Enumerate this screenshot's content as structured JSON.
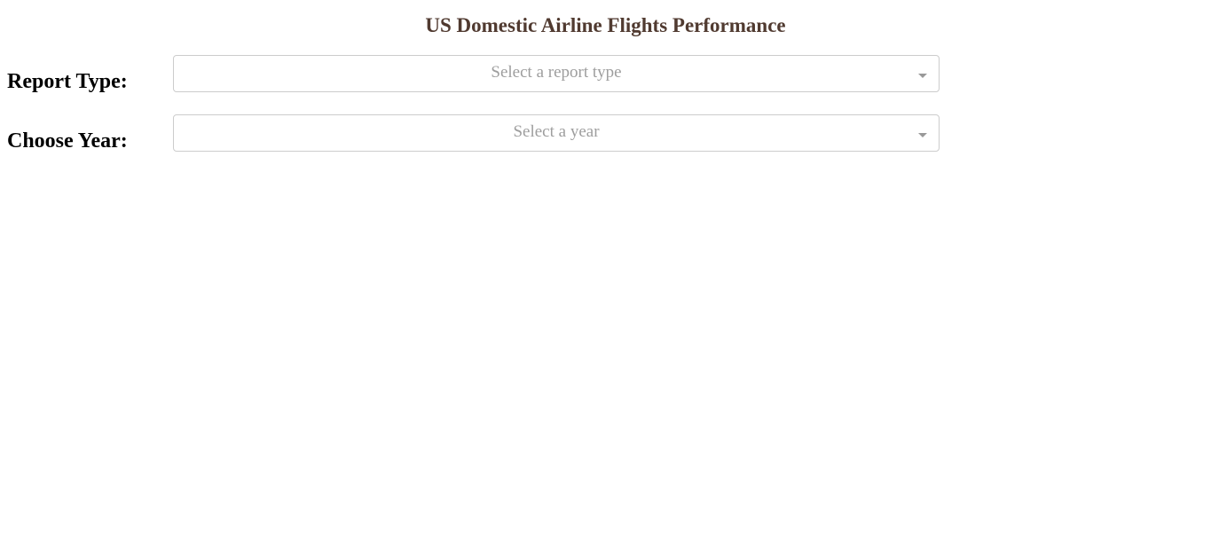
{
  "header": {
    "title": "US Domestic Airline Flights Performance"
  },
  "form": {
    "report_type": {
      "label": "Report Type:",
      "placeholder": "Select a report type"
    },
    "year": {
      "label": "Choose Year:",
      "placeholder": "Select a year"
    }
  },
  "icons": {
    "dropdown_arrow": "caret-down-icon"
  },
  "colors": {
    "title": "#503a30",
    "placeholder": "#9e9e9e",
    "border": "#cccccc"
  }
}
